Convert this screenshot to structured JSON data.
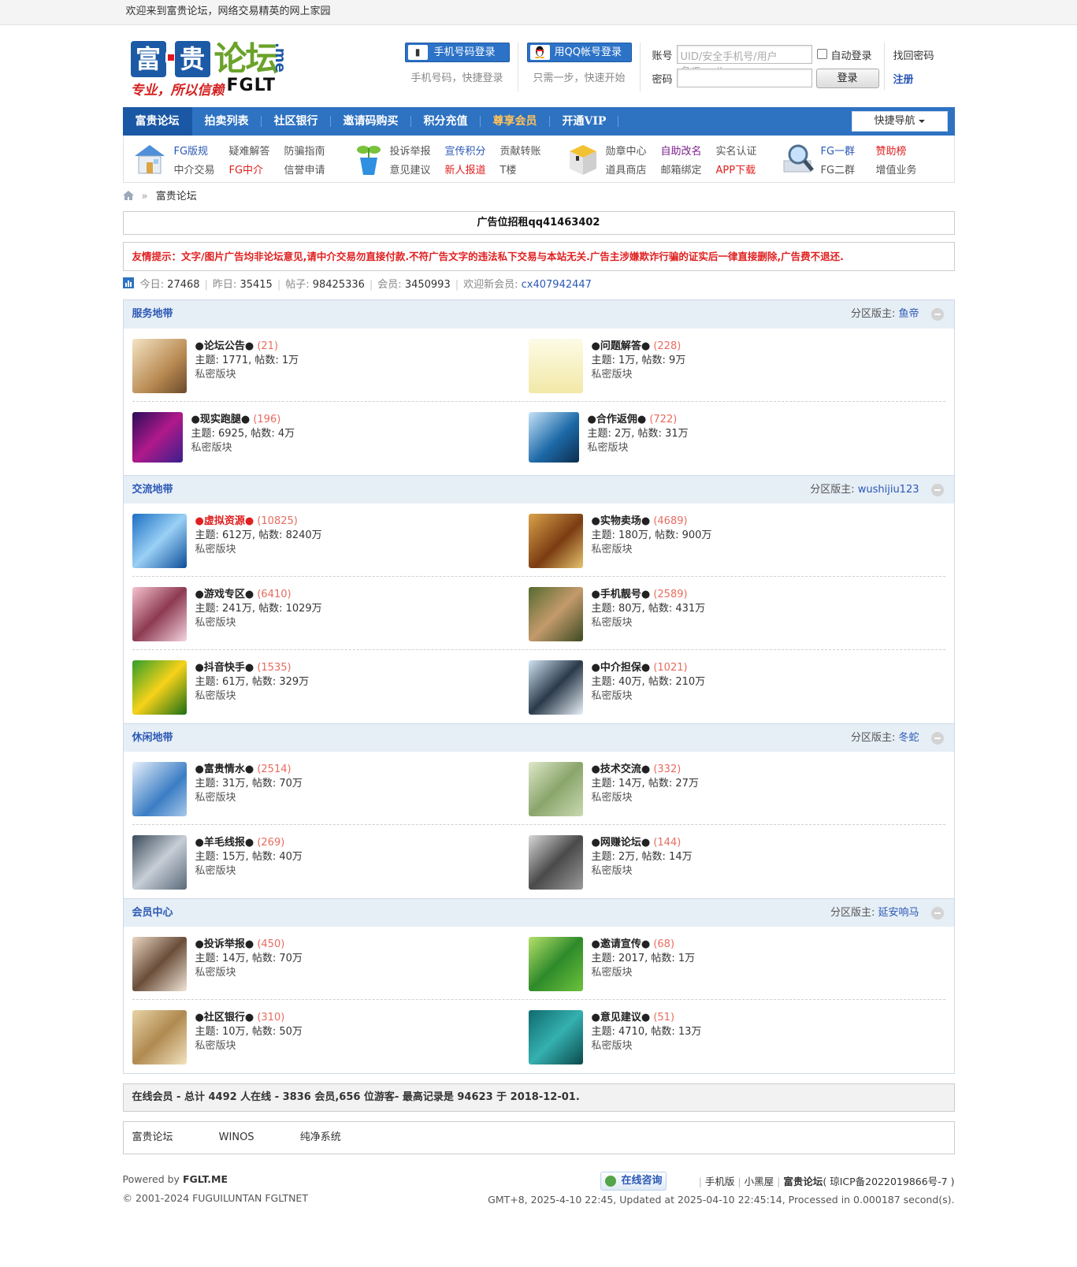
{
  "topbar": {
    "welcome": "欢迎来到富贵论坛，网络交易精英的网上家园"
  },
  "logo": {
    "char1": "富",
    "char2": "贵",
    "name": "论坛",
    "slogan": "专业，所以信赖",
    "fglt": "FGLT",
    "me": ".me"
  },
  "login": {
    "phone_btn": "手机号码登录",
    "phone_sub": "手机号码，快捷登录",
    "qq_btn": "用QQ帐号登录",
    "qq_sub": "只需一步，快速开始",
    "account_label": "账号",
    "account_placeholder": "UID/安全手机号/用户名/Email",
    "auto_login": "自动登录",
    "find_pwd": "找回密码",
    "password_label": "密码",
    "login_btn": "登录",
    "register": "注册"
  },
  "nav": {
    "items": [
      "富贵论坛",
      "拍卖列表",
      "社区银行",
      "邀请码购买",
      "积分充值",
      "尊享会员",
      "开通VIP"
    ],
    "quick": "快捷导航"
  },
  "subnav": {
    "g1": [
      "FG版规",
      "疑难解答",
      "防骗指南",
      "中介交易",
      "FG中介",
      "信誉申请"
    ],
    "g2": [
      "投诉举报",
      "宣传积分",
      "贡献转账",
      "意见建议",
      "新人报道",
      "T楼"
    ],
    "g3": [
      "勋章中心",
      "自助改名",
      "实名认证",
      "道具商店",
      "邮箱绑定",
      "APP下载"
    ],
    "g4": [
      "FG一群",
      "赞助榜",
      "FG二群",
      "增值业务"
    ]
  },
  "crumb": {
    "sep": "»",
    "text": "富贵论坛"
  },
  "ad": "广告位招租qq41463402",
  "tip": "友情提示：文字/图片广告均非论坛意见,请中介交易勿直接付款.不符广告文字的违法私下交易与本站无关.广告主涉嫌欺诈行骗的证实后一律直接删除,广告费不退还.",
  "stats": {
    "today_label": "今日:",
    "today": "27468",
    "yesterday_label": "昨日:",
    "yesterday": "35415",
    "posts_label": "帖子:",
    "posts": "98425336",
    "members_label": "会员:",
    "members": "3450993",
    "newest_label": "欢迎新会员:",
    "newest": "cx407942447"
  },
  "sections": [
    {
      "title": "服务地带",
      "mod_label": "分区版主:",
      "mod": "鱼帝",
      "rows": [
        [
          {
            "name": "●论坛公告●",
            "count": "(21)",
            "stats": "主题: 1771, 帖数: 1万",
            "priv": "私密版块"
          },
          {
            "name": "●问题解答●",
            "count": "(228)",
            "stats": "主题: 1万, 帖数: 9万",
            "priv": "私密版块"
          }
        ],
        [
          {
            "name": "●现实跑腿●",
            "count": "(196)",
            "stats": "主题: 6925, 帖数: 4万",
            "priv": "私密版块"
          },
          {
            "name": "●合作返佣●",
            "count": "(722)",
            "stats": "主题: 2万, 帖数: 31万",
            "priv": "私密版块"
          }
        ]
      ]
    },
    {
      "title": "交流地带",
      "mod_label": "分区版主:",
      "mod": "wushijiu123",
      "rows": [
        [
          {
            "name": "●虚拟资源●",
            "count": "(10825)",
            "stats": "主题: 612万, 帖数: 8240万",
            "priv": "私密版块"
          },
          {
            "name": "●实物卖场●",
            "count": "(4689)",
            "stats": "主题: 180万, 帖数: 900万",
            "priv": "私密版块"
          }
        ],
        [
          {
            "name": "●游戏专区●",
            "count": "(6410)",
            "stats": "主题: 241万, 帖数: 1029万",
            "priv": "私密版块"
          },
          {
            "name": "●手机靓号●",
            "count": "(2589)",
            "stats": "主题: 80万, 帖数: 431万",
            "priv": "私密版块"
          }
        ],
        [
          {
            "name": "●抖音快手●",
            "count": "(1535)",
            "stats": "主题: 61万, 帖数: 329万",
            "priv": "私密版块"
          },
          {
            "name": "●中介担保●",
            "count": "(1021)",
            "stats": "主题: 40万, 帖数: 210万",
            "priv": "私密版块"
          }
        ]
      ]
    },
    {
      "title": "休闲地带",
      "mod_label": "分区版主:",
      "mod": "冬蛇",
      "rows": [
        [
          {
            "name": "●富贵情水●",
            "count": "(2514)",
            "stats": "主题: 31万, 帖数: 70万",
            "priv": "私密版块"
          },
          {
            "name": "●技术交流●",
            "count": "(332)",
            "stats": "主题: 14万, 帖数: 27万",
            "priv": "私密版块"
          }
        ],
        [
          {
            "name": "●羊毛线报●",
            "count": "(269)",
            "stats": "主题: 15万, 帖数: 40万",
            "priv": "私密版块"
          },
          {
            "name": "●网赚论坛●",
            "count": "(144)",
            "stats": "主题: 2万, 帖数: 14万",
            "priv": "私密版块"
          }
        ]
      ]
    },
    {
      "title": "会员中心",
      "mod_label": "分区版主:",
      "mod": "延安响马",
      "rows": [
        [
          {
            "name": "●投诉举报●",
            "count": "(450)",
            "stats": "主题: 14万, 帖数: 70万",
            "priv": "私密版块"
          },
          {
            "name": "●邀请宣传●",
            "count": "(68)",
            "stats": "主题: 2017, 帖数: 1万",
            "priv": "私密版块"
          }
        ],
        [
          {
            "name": "●社区银行●",
            "count": "(310)",
            "stats": "主题: 10万, 帖数: 50万",
            "priv": "私密版块"
          },
          {
            "name": "●意见建议●",
            "count": "(51)",
            "stats": "主题: 4710, 帖数: 13万",
            "priv": "私密版块"
          }
        ]
      ]
    }
  ],
  "online": "在线会员 - 总计 4492 人在线 - 3836 会员,656 位游客- 最高记录是 94623 于 2018-12-01.",
  "links": [
    "富贵论坛",
    "WINOS",
    "纯净系统"
  ],
  "footer": {
    "powered_label": "Powered by",
    "powered": "FGLT.ME",
    "copyright": "© 2001-2024 FUGUILUNTAN FGLTNET",
    "consult": "在线咨询",
    "mobile": "手机版",
    "blackroom": "小黑屋",
    "site": "富贵论坛",
    "icp": "( 琼ICP备2022019866号-7 )",
    "time": "GMT+8, 2025-4-10 22:45, Updated at 2025-04-10 22:45:14, Processed in 0.000187 second(s)."
  }
}
